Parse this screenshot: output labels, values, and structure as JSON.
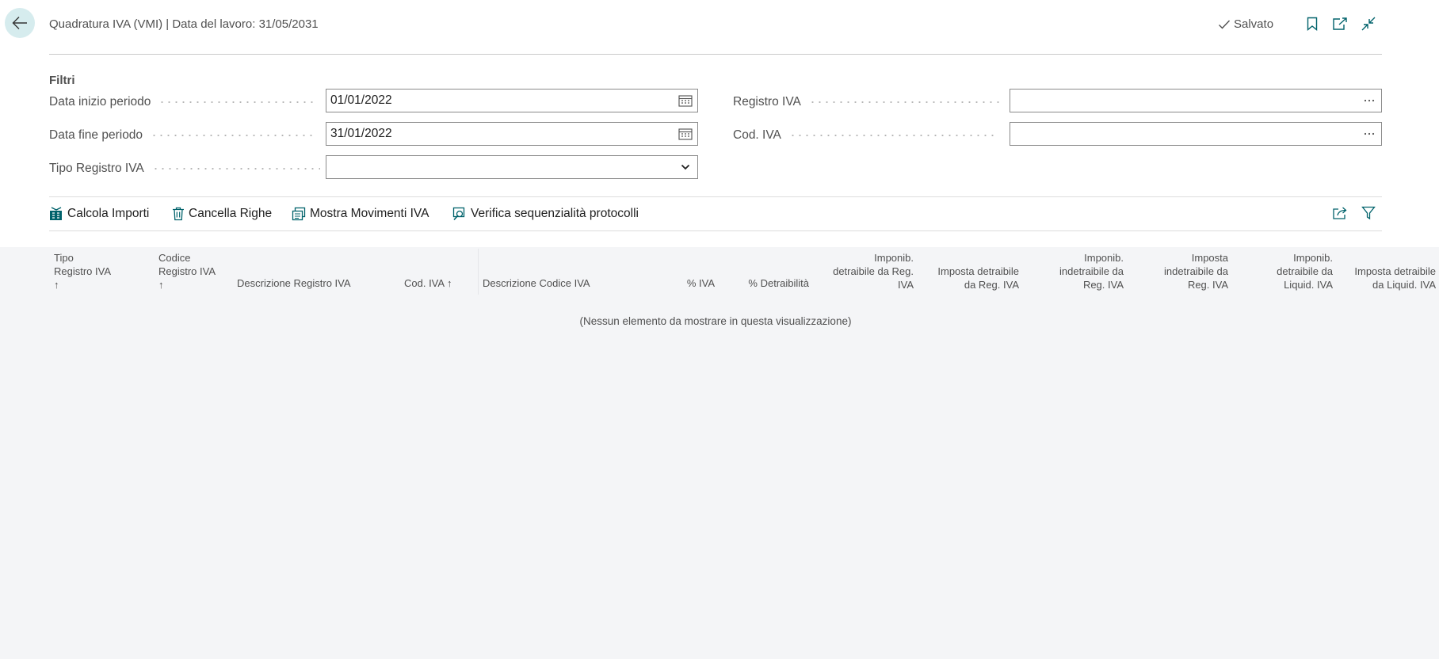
{
  "header": {
    "title": "Quadratura IVA (VMI) | Data del lavoro: 31/05/2031",
    "saved_label": "Salvato"
  },
  "filters": {
    "heading": "Filtri",
    "data_inizio": {
      "label": "Data inizio periodo",
      "value": "01/01/2022"
    },
    "data_fine": {
      "label": "Data fine periodo",
      "value": "31/01/2022"
    },
    "tipo_registro": {
      "label": "Tipo Registro IVA",
      "value": ""
    },
    "registro_iva": {
      "label": "Registro IVA",
      "value": ""
    },
    "cod_iva": {
      "label": "Cod. IVA",
      "value": ""
    }
  },
  "actions": {
    "calcola": "Calcola Importi",
    "cancella": "Cancella Righe",
    "mostra": "Mostra Movimenti IVA",
    "verifica": "Verifica sequenzialità protocolli"
  },
  "table": {
    "columns": [
      {
        "l1": "Tipo",
        "l2": "Registro IVA",
        "l3": "↑"
      },
      {
        "l1": "Codice",
        "l2": "Registro IVA",
        "l3": "↑"
      },
      {
        "l1": "Descrizione Registro IVA"
      },
      {
        "l1": "Cod. IVA ↑"
      },
      {
        "l1": "Descrizione Codice IVA"
      },
      {
        "l1": "% IVA"
      },
      {
        "l1": "% Detraibilità"
      },
      {
        "l1": "Imponib.",
        "l2": "detraibile da Reg.",
        "l3": "IVA"
      },
      {
        "l1": "Imposta detraibile",
        "l2": "da Reg. IVA"
      },
      {
        "l1": "Imponib.",
        "l2": "indetraibile da",
        "l3": "Reg. IVA"
      },
      {
        "l1": "Imposta",
        "l2": "indetraibile da",
        "l3": "Reg. IVA"
      },
      {
        "l1": "Imponib.",
        "l2": "detraibile da",
        "l3": "Liquid. IVA"
      },
      {
        "l1": "Imposta detraibile",
        "l2": "da Liquid. IVA"
      }
    ],
    "rows": [],
    "empty_message": "(Nessun elemento da mostrare in questa visualizzazione)"
  },
  "colors": {
    "accent": "#00626b",
    "back_button_bg": "#d6ecee",
    "grid_bg": "#f4f5f7"
  }
}
